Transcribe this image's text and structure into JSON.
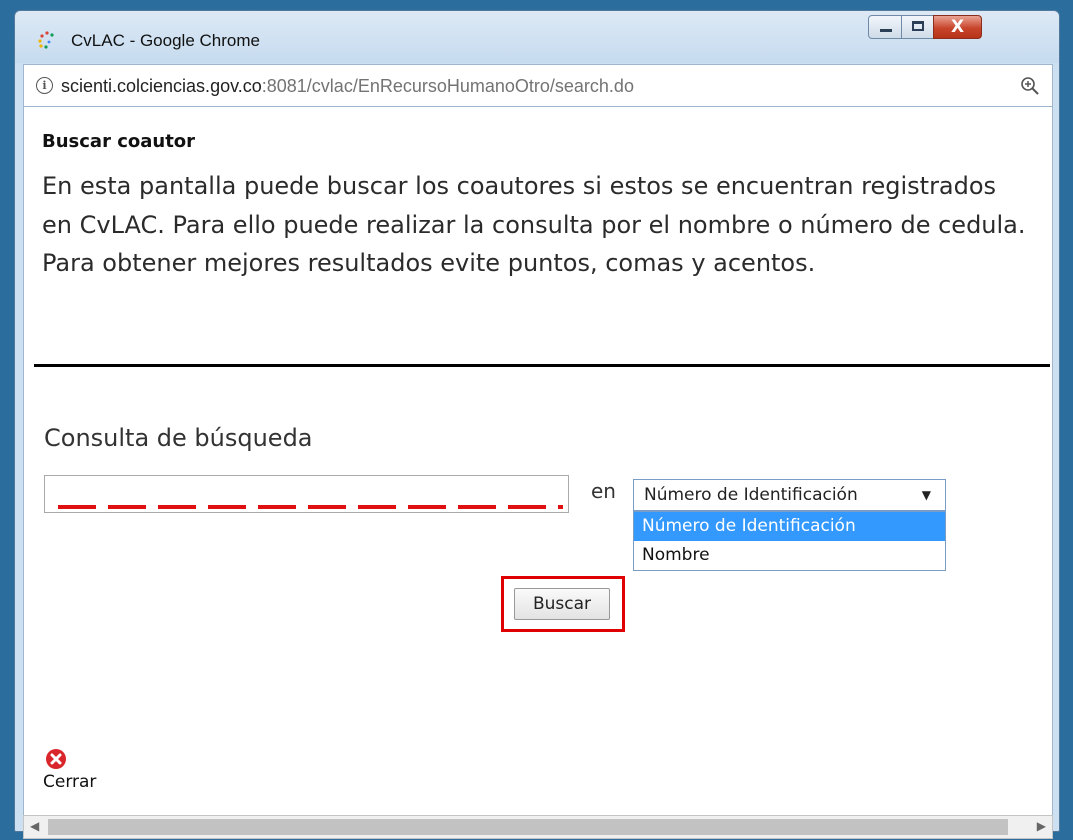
{
  "window": {
    "title": "CvLAC - Google Chrome",
    "close_glyph": "X"
  },
  "address": {
    "host": "scienti.colciencias.gov.co",
    "rest": ":8081/cvlac/EnRecursoHumanoOtro/search.do",
    "info_glyph": "i"
  },
  "page": {
    "heading": "Buscar coautor",
    "description": "En esta pantalla puede buscar los coautores si estos se encuentran registrados en CvLAC. Para ello puede realizar la consulta por el nombre o número de cedula. Para obtener mejores resultados evite puntos, comas y acentos.",
    "query_label": "Consulta de búsqueda",
    "query_value": "",
    "in_label": "en",
    "select_value": "Número de Identificación",
    "options": [
      "Número de Identificación",
      "Nombre"
    ],
    "search_button": "Buscar",
    "close_label": "Cerrar"
  },
  "colors": {
    "highlight": "#e00000",
    "option_selected": "#3399ff"
  }
}
